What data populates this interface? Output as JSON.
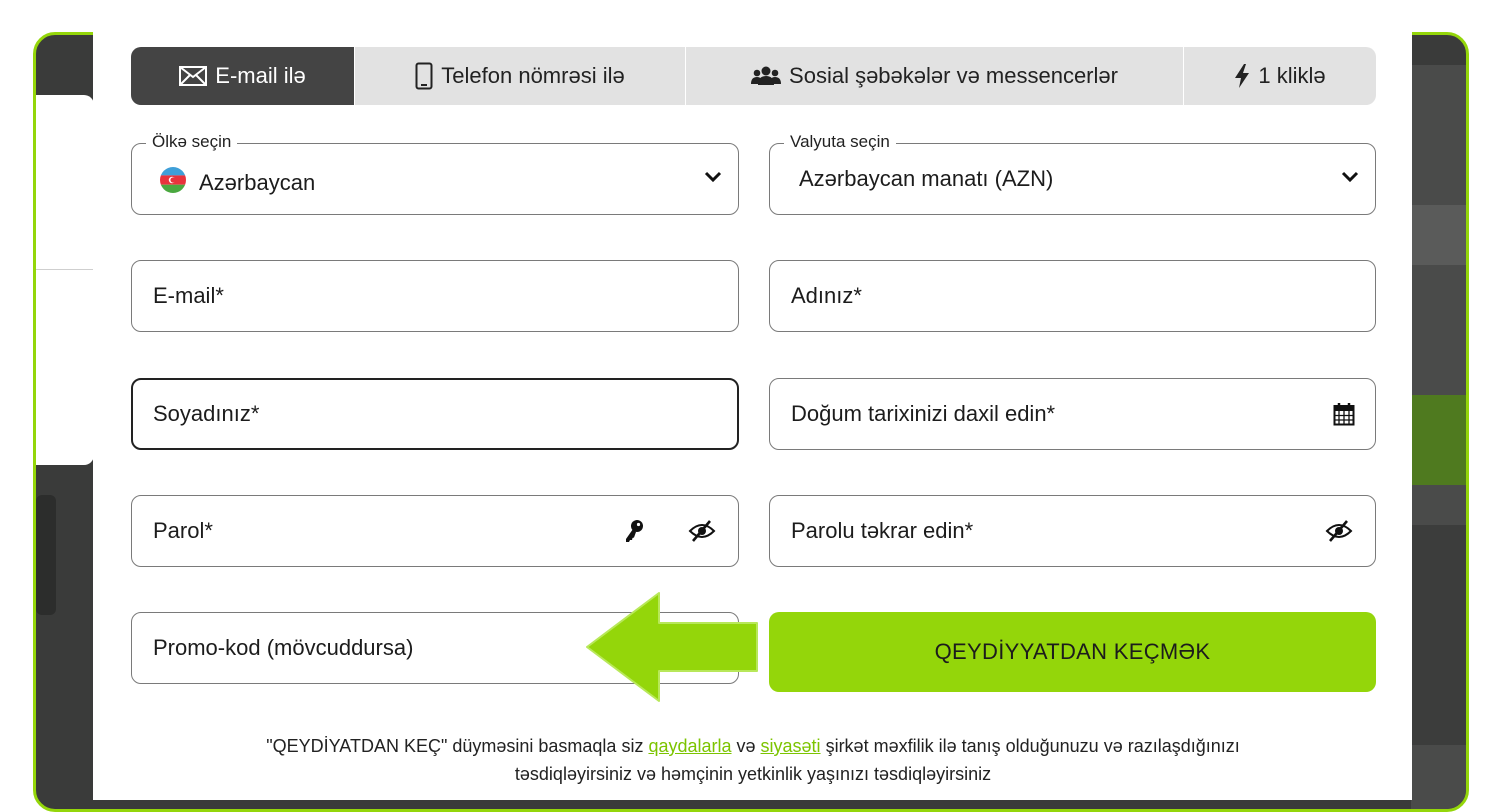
{
  "tabs": [
    {
      "label": "E-mail ilə",
      "icon": "envelope-icon",
      "active": true
    },
    {
      "label": "Telefon nömrəsi ilə",
      "icon": "phone-icon",
      "active": false
    },
    {
      "label": "Sosial şəbəkələr və messencerlər",
      "icon": "users-icon",
      "active": false
    },
    {
      "label": "1 kliklə",
      "icon": "lightning-icon",
      "active": false
    }
  ],
  "country": {
    "legend": "Ölkə seçin",
    "value": "Azərbaycan",
    "flag": "azerbaijan-flag-icon"
  },
  "currency": {
    "legend": "Valyuta seçin",
    "value": "Azərbaycan manatı (AZN)"
  },
  "fields": {
    "email": "E-mail*",
    "first_name": "Adınız*",
    "last_name": "Soyadınız*",
    "birth_date": "Doğum tarixinizi daxil edin*",
    "password": "Parol*",
    "password_repeat": "Parolu təkrar edin*",
    "promo": "Promo-kod (mövcuddursa)"
  },
  "submit_label": "QEYDİYYATDAN KEÇMƏK",
  "terms": {
    "part1": "\"QEYDİYATDAN KEÇ\" düyməsini basmaqla siz ",
    "link1": "qaydalarla",
    "part2": " və ",
    "link2": "siyasəti",
    "part3": " şirkət məxfilik ilə tanış olduğunuzu və razılaşdığınızı",
    "line2": "təsdiqləyirsiniz və həmçinin yetkinlik yaşınızı təsdiqləyirsiniz"
  },
  "colors": {
    "accent": "#94d60a",
    "tab_active": "#444444",
    "tab_bg": "#e2e2e2",
    "link": "#7cc400"
  }
}
